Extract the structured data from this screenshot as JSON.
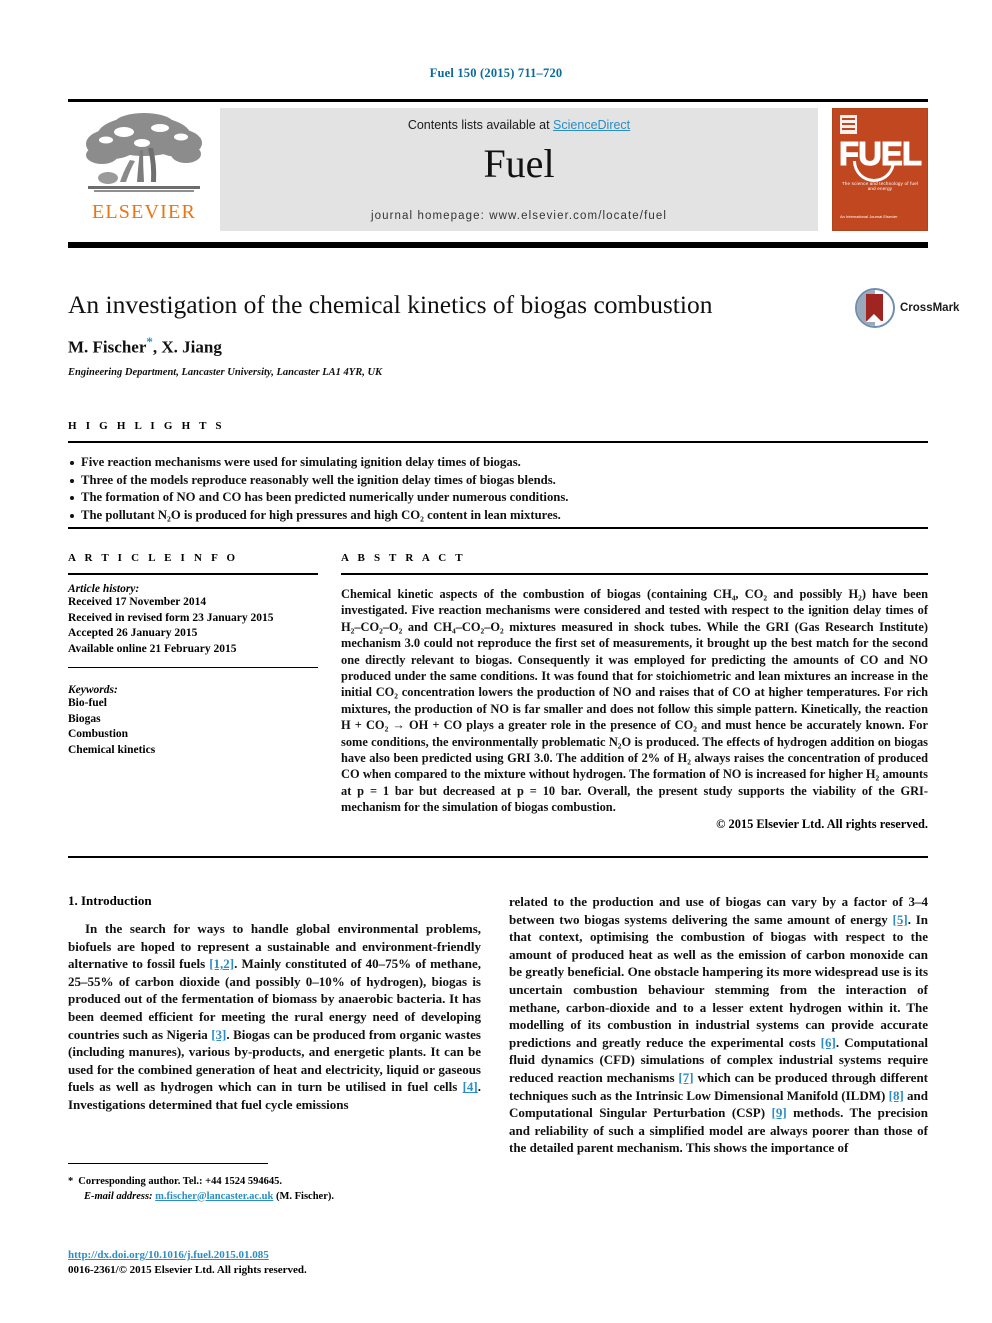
{
  "running_head": "Fuel 150 (2015) 711–720",
  "masthead": {
    "publisher_name": "ELSEVIER",
    "contents_prefix": "Contents lists available at ",
    "sciencedirect": "ScienceDirect",
    "journal_title": "Fuel",
    "homepage": "journal homepage: www.elsevier.com/locate/fuel",
    "cover": {
      "word": "FUEL",
      "subtitle": "The science and technology of fuel and energy",
      "footer": "An International Journal\nElsevier"
    }
  },
  "article": {
    "title": "An investigation of the chemical kinetics of biogas combustion",
    "authors": "M. Fischer",
    "author_star": "*",
    "authors_rest": ", X. Jiang",
    "affiliation": "Engineering Department, Lancaster University, Lancaster LA1 4YR, UK",
    "crossmark_label": "CrossMark"
  },
  "highlights": {
    "heading": "H I G H L I G H T S",
    "items": [
      "Five reaction mechanisms were used for simulating ignition delay times of biogas.",
      "Three of the models reproduce reasonably well the ignition delay times of biogas blends.",
      "The formation of NO and CO has been predicted numerically under numerous conditions.",
      "The pollutant N₂O is produced for high pressures and high CO₂ content in lean mixtures."
    ]
  },
  "article_info": {
    "heading": "A R T I C L E   I N F O",
    "history_label": "Article history:",
    "history": [
      "Received 17 November 2014",
      "Received in revised form 23 January 2015",
      "Accepted 26 January 2015",
      "Available online 21 February 2015"
    ],
    "keywords_label": "Keywords:",
    "keywords": [
      "Bio-fuel",
      "Biogas",
      "Combustion",
      "Chemical kinetics"
    ]
  },
  "abstract": {
    "heading": "A B S T R A C T",
    "body": "Chemical kinetic aspects of the combustion of biogas (containing CH₄, CO₂ and possibly H₂) have been investigated. Five reaction mechanisms were considered and tested with respect to the ignition delay times of H₂–CO₂–O₂ and CH₄–CO₂–O₂ mixtures measured in shock tubes. While the GRI (Gas Research Institute) mechanism 3.0 could not reproduce the first set of measurements, it brought up the best match for the second one directly relevant to biogas. Consequently it was employed for predicting the amounts of CO and NO produced under the same conditions. It was found that for stoichiometric and lean mixtures an increase in the initial CO₂ concentration lowers the production of NO and raises that of CO at higher temperatures. For rich mixtures, the production of NO is far smaller and does not follow this simple pattern. Kinetically, the reaction H + CO₂ → OH + CO plays a greater role in the presence of CO₂ and must hence be accurately known. For some conditions, the environmentally problematic N₂O is produced. The effects of hydrogen addition on biogas have also been predicted using GRI 3.0. The addition of 2% of H₂ always raises the concentration of produced CO when compared to the mixture without hydrogen. The formation of NO is increased for higher H₂ amounts at p = 1 bar but decreased at p = 10 bar. Overall, the present study supports the viability of the GRI-mechanism for the simulation of biogas combustion.",
    "copyright": "© 2015 Elsevier Ltd. All rights reserved."
  },
  "introduction": {
    "section_title": "1. Introduction",
    "left_paragraph_part1": "In the search for ways to handle global environmental problems, biofuels are hoped to represent a sustainable and environment-friendly alternative to fossil fuels ",
    "ref_1_2": "[1,2]",
    "left_paragraph_part2": ". Mainly constituted of 40–75% of methane, 25–55% of carbon dioxide (and possibly 0–10% of hydrogen), biogas is produced out of the fermentation of biomass by anaerobic bacteria. It has been deemed efficient for meeting the rural energy need of developing countries such as Nigeria ",
    "ref_3": "[3]",
    "left_paragraph_part3": ". Biogas can be produced from organic wastes (including manures), various by-products, and energetic plants. It can be used for the combined generation of heat and electricity, liquid or gaseous fuels as well as hydrogen which can in turn be utilised in fuel cells ",
    "ref_4": "[4]",
    "left_paragraph_part4": ". Investigations determined that fuel cycle emissions",
    "right_paragraph_part1": "related to the production and use of biogas can vary by a factor of 3–4 between two biogas systems delivering the same amount of energy ",
    "ref_5": "[5]",
    "right_paragraph_part2": ". In that context, optimising the combustion of biogas with respect to the amount of produced heat as well as the emission of carbon monoxide can be greatly beneficial. One obstacle hampering its more widespread use is its uncertain combustion behaviour stemming from the interaction of methane, carbon-dioxide and to a lesser extent hydrogen within it. The modelling of its combustion in industrial systems can provide accurate predictions and greatly reduce the experimental costs ",
    "ref_6": "[6]",
    "right_paragraph_part3": ". Computational fluid dynamics (CFD) simulations of complex industrial systems require reduced reaction mechanisms ",
    "ref_7": "[7]",
    "right_paragraph_part4": " which can be produced through different techniques such as the Intrinsic Low Dimensional Manifold (ILDM) ",
    "ref_8": "[8]",
    "right_paragraph_part5": " and Computational Singular Perturbation (CSP) ",
    "ref_9": "[9]",
    "right_paragraph_part6": " methods. The precision and reliability of such a simplified model are always poorer than those of the detailed parent mechanism. This shows the importance of"
  },
  "footnotes": {
    "corresponding_star": "*",
    "corresponding": "Corresponding author. Tel.: +44 1524 594645.",
    "email_label": "E-mail address:",
    "email": "m.fischer@lancaster.ac.uk",
    "email_attrib": "(M. Fischer).",
    "doi": "http://dx.doi.org/10.1016/j.fuel.2015.01.085",
    "issn_copyright": "0016-2361/© 2015 Elsevier Ltd. All rights reserved."
  },
  "colors": {
    "link_blue": "#2b8dc3",
    "header_blue": "#0b6a9b",
    "elsevier_orange": "#e87511",
    "cover_orange": "#c0471f",
    "band_gray": "#e3e3e3"
  }
}
